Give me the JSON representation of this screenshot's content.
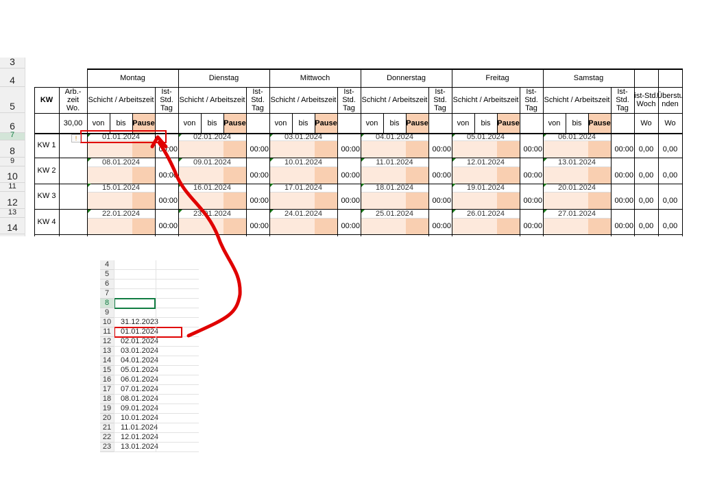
{
  "sheet": {
    "row_numbers": [
      "3",
      "4",
      "5",
      "6",
      "7",
      "8",
      "9",
      "10",
      "11",
      "12",
      "13",
      "14"
    ],
    "corner_kw": "KW",
    "arbzeit_label": "Arb.-\nzeit\nWo.",
    "arbzeit_value": "30,00",
    "days": [
      "Montag",
      "Dienstag",
      "Mittwoch",
      "Donnerstag",
      "Freitag",
      "Samstag"
    ],
    "shift_label": "Schicht / Arbeitszeit",
    "ist_tag_label": "Ist-\nStd.\nTag",
    "von": "von",
    "bis": "bis",
    "pause": "Pause",
    "ist_woch_label": "ist-Std.\nWoch",
    "ueberstunden_label": "Überstu\nnden",
    "wo": "Wo",
    "weeks": [
      {
        "kw": "KW 1",
        "dates": [
          "01.01.2024",
          "02.01.2024",
          "03.01.2024",
          "04.01.2024",
          "05.01.2024",
          "06.01.2024"
        ],
        "time": "00:00",
        "ist": "0,00",
        "ueber": "0,00"
      },
      {
        "kw": "KW 2",
        "dates": [
          "08.01.2024",
          "09.01.2024",
          "10.01.2024",
          "11.01.2024",
          "12.01.2024",
          "13.01.2024"
        ],
        "time": "00:00",
        "ist": "0,00",
        "ueber": "0,00"
      },
      {
        "kw": "KW 3",
        "dates": [
          "15.01.2024",
          "16.01.2024",
          "17.01.2024",
          "18.01.2024",
          "19.01.2024",
          "20.01.2024"
        ],
        "time": "00:00",
        "ist": "0,00",
        "ueber": "0,00"
      },
      {
        "kw": "KW 4",
        "dates": [
          "22.01.2024",
          "23.01.2024",
          "24.01.2024",
          "25.01.2024",
          "26.01.2024",
          "27.01.2024"
        ],
        "time": "00:00",
        "ist": "0,00",
        "ueber": "0,00"
      }
    ],
    "warning_icon": "warning-icon"
  },
  "sheet2": {
    "rows": [
      {
        "n": "4",
        "v": ""
      },
      {
        "n": "5",
        "v": ""
      },
      {
        "n": "6",
        "v": ""
      },
      {
        "n": "7",
        "v": ""
      },
      {
        "n": "8",
        "v": ""
      },
      {
        "n": "9",
        "v": ""
      },
      {
        "n": "10",
        "v": "31.12.2023"
      },
      {
        "n": "11",
        "v": "01.01.2024"
      },
      {
        "n": "12",
        "v": "02.01.2024"
      },
      {
        "n": "13",
        "v": "03.01.2024"
      },
      {
        "n": "14",
        "v": "04.01.2024"
      },
      {
        "n": "15",
        "v": "05.01.2024"
      },
      {
        "n": "16",
        "v": "06.01.2024"
      },
      {
        "n": "17",
        "v": "07.01.2024"
      },
      {
        "n": "18",
        "v": "08.01.2024"
      },
      {
        "n": "19",
        "v": "09.01.2024"
      },
      {
        "n": "20",
        "v": "10.01.2024"
      },
      {
        "n": "21",
        "v": "11.01.2024"
      },
      {
        "n": "22",
        "v": "12.01.2024"
      },
      {
        "n": "23",
        "v": "13.01.2024"
      }
    ],
    "selected_row": "8"
  },
  "colors": {
    "highlight": "#e00000",
    "peach_light": "#fde9dc",
    "peach_dark": "#f9cfb1",
    "excel_green": "#107c41"
  }
}
